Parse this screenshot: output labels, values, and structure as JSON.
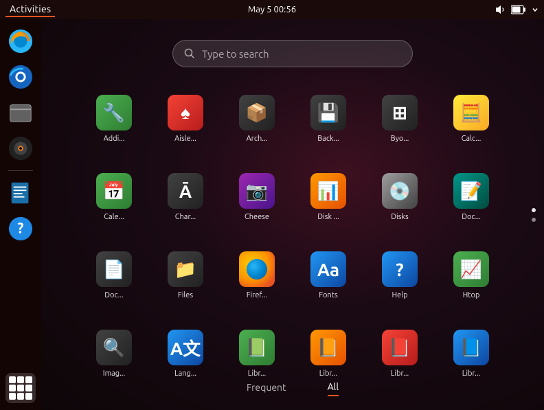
{
  "topbar": {
    "activities_label": "Activities",
    "datetime": "May 5  00:56"
  },
  "search": {
    "placeholder": "Type to search"
  },
  "tabs": [
    {
      "id": "frequent",
      "label": "Frequent",
      "active": false
    },
    {
      "id": "all",
      "label": "All",
      "active": true
    }
  ],
  "apps": [
    {
      "name": "Addi...",
      "color": "ic-green",
      "icon": "🔧"
    },
    {
      "name": "Aisle...",
      "color": "ic-red",
      "icon": "♠"
    },
    {
      "name": "Arch...",
      "color": "ic-dark",
      "icon": "📦"
    },
    {
      "name": "Back...",
      "color": "ic-dark",
      "icon": "💾"
    },
    {
      "name": "Byo...",
      "color": "ic-dark",
      "icon": "⊞"
    },
    {
      "name": "Calc...",
      "color": "ic-yellow",
      "icon": "🧮"
    },
    {
      "name": "Cale...",
      "color": "ic-green",
      "icon": "📅"
    },
    {
      "name": "Char...",
      "color": "ic-dark",
      "icon": "Ā"
    },
    {
      "name": "Cheese",
      "color": "ic-purple",
      "icon": "📷"
    },
    {
      "name": "Disk ...",
      "color": "ic-orange",
      "icon": "📊"
    },
    {
      "name": "Disks",
      "color": "ic-gray",
      "icon": "💿"
    },
    {
      "name": "Doc...",
      "color": "ic-teal",
      "icon": "📝"
    },
    {
      "name": "Doc...",
      "color": "ic-dark",
      "icon": "📄"
    },
    {
      "name": "Files",
      "color": "ic-dark",
      "icon": "📁"
    },
    {
      "name": "Firef...",
      "color": "firefox",
      "icon": "🦊"
    },
    {
      "name": "Fonts",
      "color": "ic-blue",
      "icon": "Aa"
    },
    {
      "name": "Help",
      "color": "ic-blue",
      "icon": "?"
    },
    {
      "name": "Htop",
      "color": "ic-green",
      "icon": "📈"
    },
    {
      "name": "Imag...",
      "color": "ic-dark",
      "icon": "🔍"
    },
    {
      "name": "Lang...",
      "color": "ic-blue",
      "icon": "A文"
    },
    {
      "name": "Libr...",
      "color": "ic-green",
      "icon": "📗"
    },
    {
      "name": "Libr...",
      "color": "ic-orange",
      "icon": "📙"
    },
    {
      "name": "Libr...",
      "color": "ic-red",
      "icon": "📕"
    },
    {
      "name": "Libr...",
      "color": "ic-blue",
      "icon": "📘"
    }
  ],
  "dock": {
    "items": [
      {
        "name": "firefox",
        "label": "Firefox"
      },
      {
        "name": "thunderbird",
        "label": "Thunderbird"
      },
      {
        "name": "files",
        "label": "Files"
      },
      {
        "name": "rhythmbox",
        "label": "Rhythmbox"
      },
      {
        "name": "writer",
        "label": "Writer"
      },
      {
        "name": "help",
        "label": "Help"
      }
    ]
  },
  "scroll_dots": [
    {
      "active": true
    },
    {
      "active": false
    }
  ]
}
